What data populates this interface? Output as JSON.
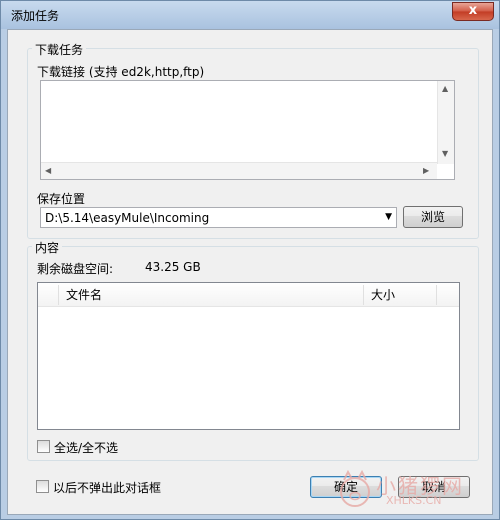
{
  "window": {
    "title": "添加任务",
    "close_glyph": "x"
  },
  "download_group": {
    "legend": "下载任务",
    "link_label": "下载链接 (支持 ed2k,http,ftp)",
    "link_value": "",
    "save_label": "保存位置",
    "save_path": "D:\\5.14\\easyMule\\Incoming",
    "browse_label": "浏览"
  },
  "content_group": {
    "legend": "内容",
    "free_space_label": "剩余磁盘空间:",
    "free_space_value": "43.25 GB",
    "columns": [
      "文件名",
      "大小"
    ],
    "select_all_label": "全选/全不选"
  },
  "footer": {
    "dont_show_label": "以后不弹出此对话框",
    "ok_label": "确定",
    "cancel_label": "取消"
  },
  "watermark": {
    "brand": "小猪猡网",
    "url": "XHLKS.CN"
  },
  "icons": {
    "up": "up-arrow-icon",
    "down": "down-arrow-icon",
    "left": "left-arrow-icon",
    "right": "right-arrow-icon",
    "dropdown": "dropdown-arrow-icon"
  },
  "colors": {
    "title_bar": "#b9cde4",
    "close": "#c23c24",
    "accent": "#3c7fb1"
  }
}
